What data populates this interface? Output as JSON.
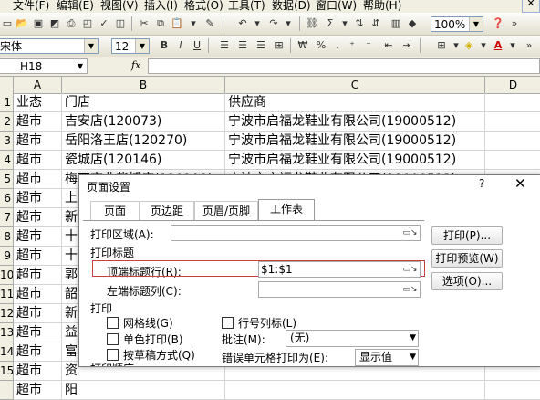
{
  "menu": {
    "items": [
      "文件(F)",
      "编辑(E)",
      "视图(V)",
      "插入(I)",
      "格式(O)",
      "工具(T)",
      "数据(D)",
      "窗口(W)",
      "帮助(H)"
    ],
    "close_label": "✕"
  },
  "toolbar": {
    "zoom": "100%",
    "font_name": "宋体",
    "font_size": "12",
    "bold": "B",
    "italic": "I",
    "underline": "U",
    "font_color_letter": "A"
  },
  "formula_bar": {
    "name_box": "H18",
    "fx": "fx"
  },
  "sheet": {
    "columns": [
      "A",
      "B",
      "C",
      "D"
    ],
    "row_numbers": [
      "1",
      "2",
      "3",
      "4",
      "5",
      "6",
      "7",
      "8",
      "9",
      "10",
      "11",
      "12",
      "13",
      "14",
      "15"
    ],
    "rows": [
      [
        "业态",
        "门店",
        "供应商"
      ],
      [
        "超市",
        "吉安店(120073)",
        "宁波市启福龙鞋业有限公司(19000512)"
      ],
      [
        "超市",
        "岳阳洛王店(120270)",
        "宁波市启福龙鞋业有限公司(19000512)"
      ],
      [
        "超市",
        "瓷城店(120146)",
        "宁波市启福龙鞋业有限公司(19000512)"
      ],
      [
        "超市",
        "梅西商业紫博店(120292)",
        "宁波市启福龙鞋业有限公司(19000512)"
      ],
      [
        "超市",
        "上",
        ""
      ],
      [
        "超市",
        "新",
        ""
      ],
      [
        "超市",
        "十",
        ""
      ],
      [
        "超市",
        "十",
        ""
      ],
      [
        "超市",
        "郭",
        ""
      ],
      [
        "超市",
        "韶",
        ""
      ],
      [
        "超市",
        "新",
        ""
      ],
      [
        "超市",
        "益",
        ""
      ],
      [
        "超市",
        "富",
        ""
      ],
      [
        "超市",
        "资",
        ""
      ],
      [
        "超市",
        "阳",
        ""
      ]
    ]
  },
  "dialog": {
    "title": "页面设置",
    "help": "?",
    "close": "✕",
    "tabs": [
      "页面",
      "页边距",
      "页眉/页脚",
      "工作表"
    ],
    "print_area_label": "打印区域(A):",
    "print_titles_label": "打印标题",
    "top_rows_label": "顶端标题行(R):",
    "top_rows_value": "$1:$1",
    "left_cols_label": "左端标题列(C):",
    "print_label": "打印",
    "gridlines_label": "网格线(G)",
    "row_col_headers_label": "行号列标(L)",
    "bw_label": "单色打印(B)",
    "comments_label": "批注(M):",
    "comments_value": "(无)",
    "draft_label": "按草稿方式(Q)",
    "errors_label": "错误单元格打印为(E):",
    "errors_value": "显示值",
    "print_button": "打印(P)...",
    "preview_button": "打印预览(W)",
    "options_button": "选项(O)...",
    "page_order_label": "打印顺序"
  }
}
